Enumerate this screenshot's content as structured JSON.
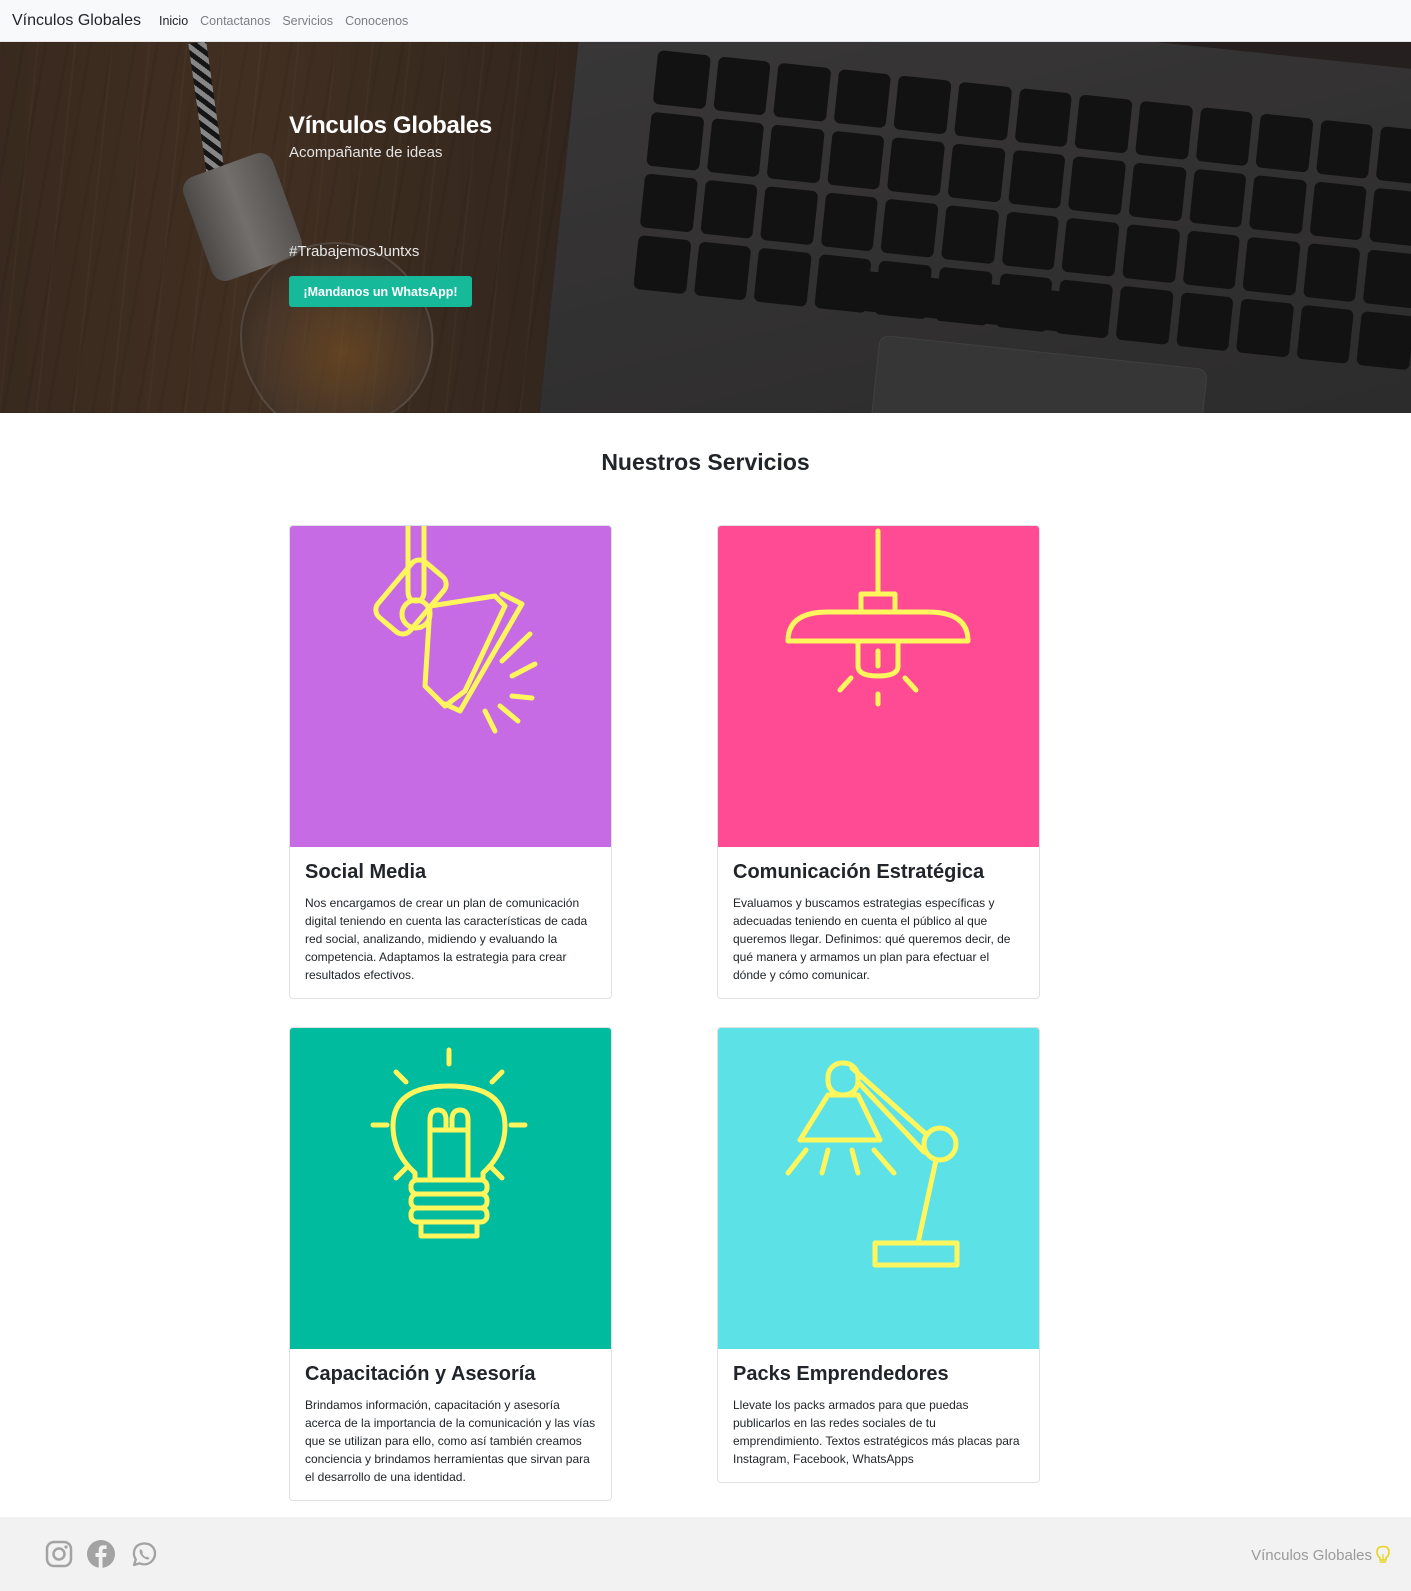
{
  "navbar": {
    "brand": "Vínculos Globales",
    "links": [
      {
        "label": "Inicio",
        "active": true
      },
      {
        "label": "Contactanos",
        "active": false
      },
      {
        "label": "Servicios",
        "active": false
      },
      {
        "label": "Conocenos",
        "active": false
      }
    ]
  },
  "hero": {
    "title": "Vínculos Globales",
    "subtitle": "Acompañante de ideas",
    "hashtag": "#TrabajemosJuntxs",
    "button_label": "¡Mandanos un WhatsApp!",
    "button_color": "#16b99a"
  },
  "services": {
    "title": "Nuestros Servicios",
    "icon_color": "#fff65e",
    "cards": [
      {
        "title": "Social Media",
        "text": "Nos encargamos de crear un plan de comunicación digital teniendo en cuenta las características de cada red social, analizando, midiendo y evaluando la competencia. Adaptamos la estrategia para crear resultados efectivos.",
        "bg_color": "#c66be3",
        "icon": "spotlight-icon"
      },
      {
        "title": "Comunicación Estratégica",
        "text": "Evaluamos y buscamos estrategias específicas y adecuadas teniendo en cuenta el público al que queremos llegar. Definimos: qué queremos decir, de qué manera y armamos un plan para efectuar el dónde y cómo comunicar.",
        "bg_color": "#ff4b93",
        "icon": "ceiling-lamp-icon"
      },
      {
        "title": "Capacitación y Asesoría",
        "text": "Brindamos información, capacitación y asesoría acerca de la importancia de la comunicación y las vías que se utilizan para ello, como así también creamos conciencia y brindamos herramientas que sirvan para el desarrollo de una identidad.",
        "bg_color": "#00bb9e",
        "icon": "lightbulb-icon"
      },
      {
        "title": "Packs Emprendedores",
        "text": "Llevate los packs armados para que puedas publicarlos en las redes sociales de tu emprendimiento. Textos estratégicos más placas para Instagram, Facebook, WhatsApps",
        "bg_color": "#5ce1e6",
        "icon": "desk-lamp-icon"
      }
    ]
  },
  "footer": {
    "social_icons": [
      "instagram-icon",
      "facebook-icon",
      "whatsapp-icon"
    ],
    "brand": "Vínculos Globales",
    "brand_icon": "lightbulb-icon"
  }
}
